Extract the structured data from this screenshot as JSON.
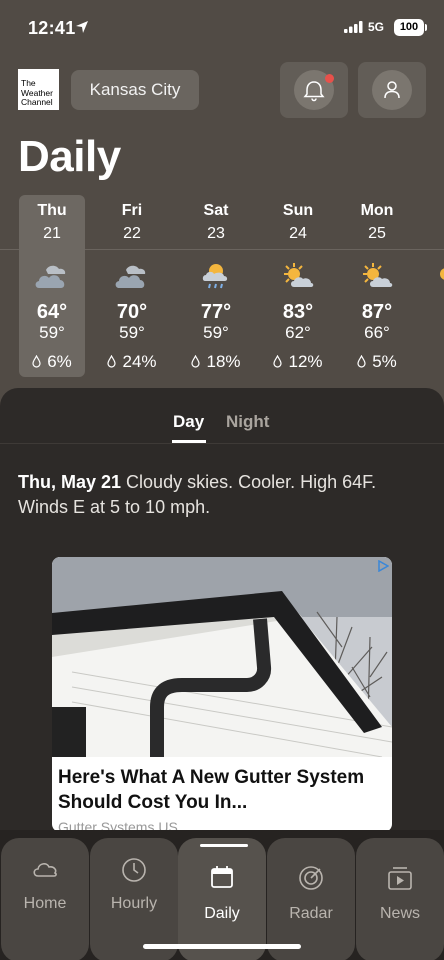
{
  "status_bar": {
    "time": "12:41",
    "network": "5G",
    "battery": "100"
  },
  "header": {
    "logo_text": "The Weather Channel",
    "location": "Kansas City",
    "title": "Daily"
  },
  "days": [
    {
      "name": "Thu",
      "date": "21",
      "high": "64°",
      "low": "59°",
      "rain": "6%",
      "icon": "cloudy-icon",
      "selected": true
    },
    {
      "name": "Fri",
      "date": "22",
      "high": "70°",
      "low": "59°",
      "rain": "24%",
      "icon": "cloudy-icon"
    },
    {
      "name": "Sat",
      "date": "23",
      "high": "77°",
      "low": "59°",
      "rain": "18%",
      "icon": "sun-cloud-rain-icon"
    },
    {
      "name": "Sun",
      "date": "24",
      "high": "83°",
      "low": "62°",
      "rain": "12%",
      "icon": "partly-cloudy-icon"
    },
    {
      "name": "Mon",
      "date": "25",
      "high": "87°",
      "low": "66°",
      "rain": "5%",
      "icon": "partly-cloudy-icon"
    }
  ],
  "detail": {
    "tabs": {
      "day": "Day",
      "night": "Night"
    },
    "date_label": "Thu, May 21",
    "forecast_text": "Cloudy skies. Cooler. High 64F. Winds E at 5 to 10 mph."
  },
  "ad": {
    "headline": "Here's What A New Gutter System Should Cost You In...",
    "source": "Gutter Systems US"
  },
  "tabbar": {
    "home": "Home",
    "hourly": "Hourly",
    "daily": "Daily",
    "radar": "Radar",
    "news": "News"
  },
  "colors": {
    "background": "#514b45",
    "panel": "#2d2a28",
    "notification_dot": "#e7514b",
    "sun": "#f4b63e"
  }
}
